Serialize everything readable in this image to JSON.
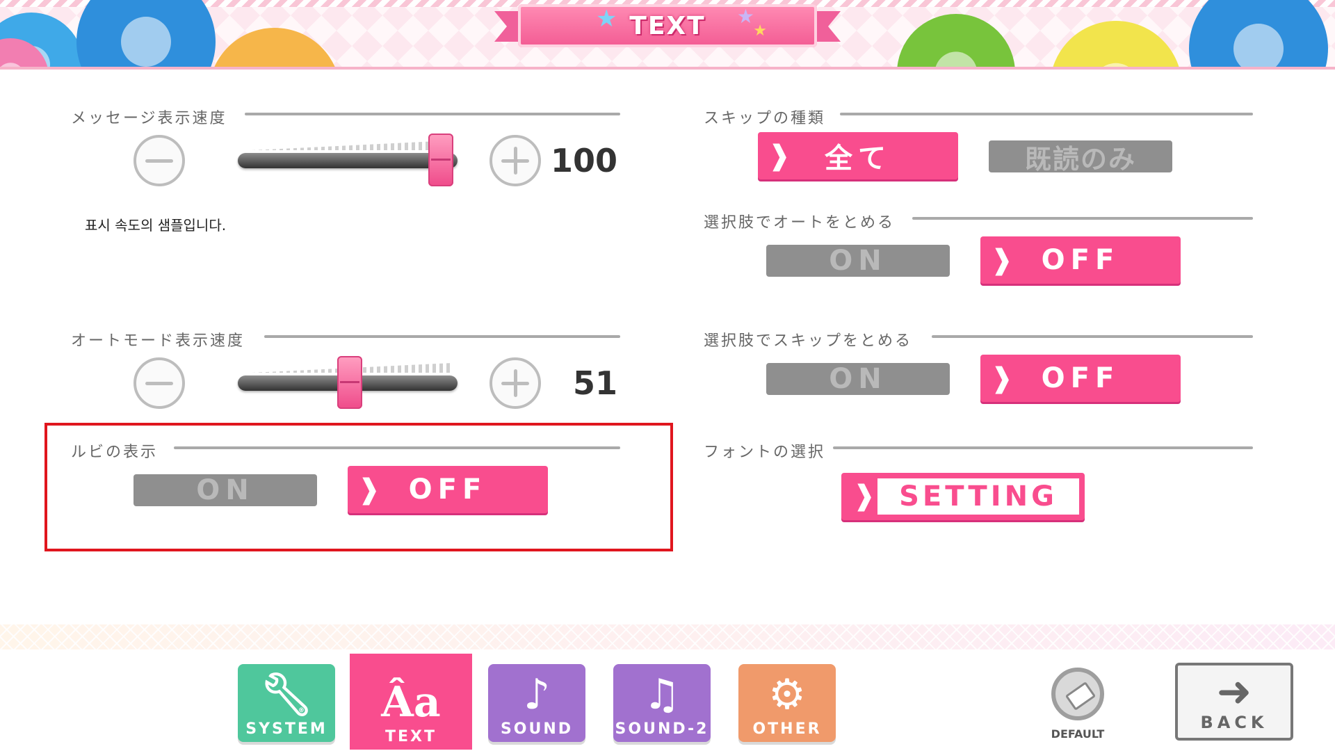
{
  "header": {
    "title": "TEXT"
  },
  "left_panel": {
    "message_speed": {
      "label": "メッセージ表示速度",
      "value": "100",
      "level": 1.0
    },
    "sample_text": "표시 속도의 샘플입니다.",
    "auto_speed": {
      "label": "オートモード表示速度",
      "value": "51",
      "level": 0.51
    },
    "ruby": {
      "label": "ルビの表示",
      "on_label": "ON",
      "off_label": "OFF",
      "selected": "OFF"
    }
  },
  "right_panel": {
    "skip_type": {
      "label": "スキップの種類",
      "all_label": "全て",
      "read_label": "既読のみ",
      "selected": "全て"
    },
    "stop_auto_on_choice": {
      "label": "選択肢でオートをとめる",
      "on_label": "ON",
      "off_label": "OFF",
      "selected": "OFF"
    },
    "stop_skip_on_choice": {
      "label": "選択肢でスキップをとめる",
      "on_label": "ON",
      "off_label": "OFF",
      "selected": "OFF"
    },
    "font_select": {
      "label": "フォントの選択",
      "button_label": "SETTING"
    }
  },
  "tabs": [
    {
      "label": "SYSTEM",
      "icon": "wrench-icon",
      "color": "#4fc79c",
      "active": false
    },
    {
      "label": "TEXT",
      "icon": "text-icon",
      "color": "#f94d8e",
      "active": true
    },
    {
      "label": "SOUND",
      "icon": "music-note-icon",
      "color": "#a171cf",
      "active": false
    },
    {
      "label": "SOUND-2",
      "icon": "music-notes-icon",
      "color": "#a171cf",
      "active": false
    },
    {
      "label": "OTHER",
      "icon": "gear-plus-icon",
      "color": "#f09a6b",
      "active": false
    }
  ],
  "footer": {
    "default_label": "DEFAULT",
    "back_label": "BACK"
  },
  "colors": {
    "accent": "#f94d8e",
    "highlight": "#e0161e",
    "inactive": "#8f8f8f"
  }
}
